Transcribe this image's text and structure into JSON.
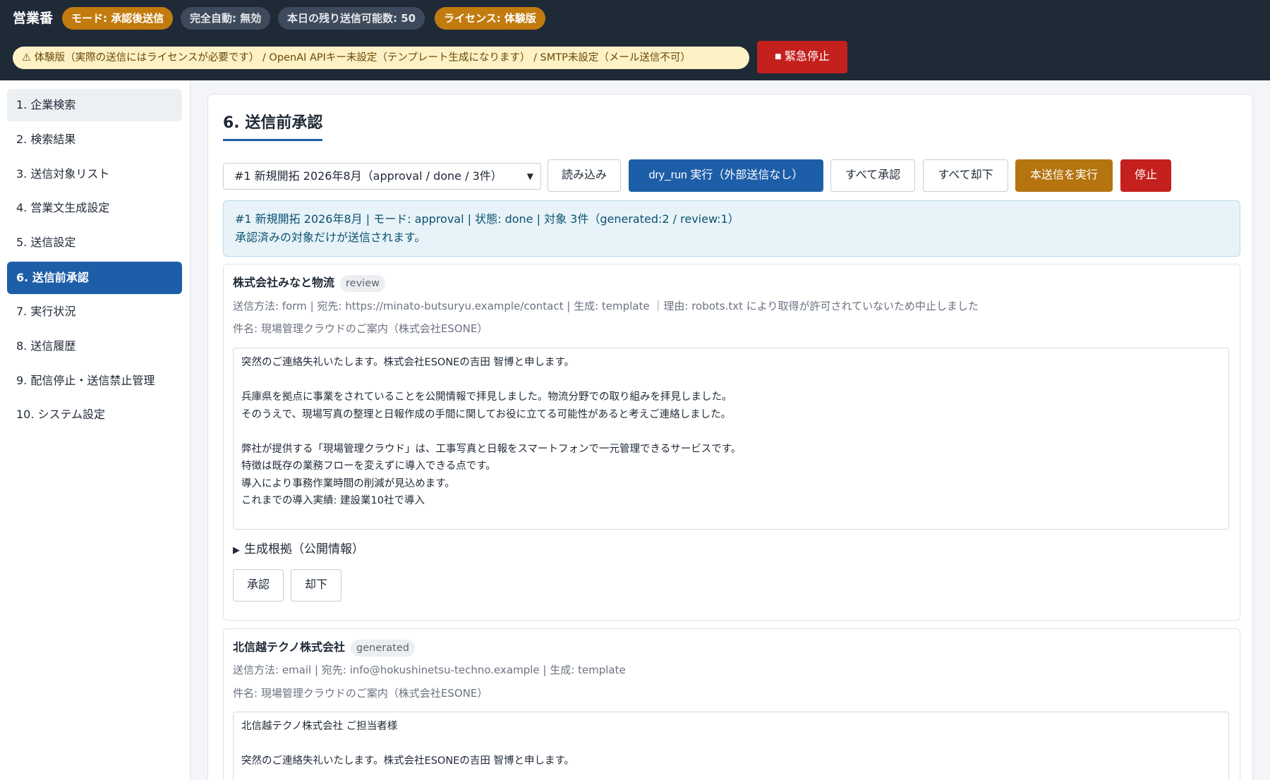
{
  "header": {
    "brand": "営業番",
    "badges": {
      "mode": "モード: 承認後送信",
      "full_auto": "完全自動: 無効",
      "remaining": "本日の残り送信可能数: 50",
      "license": "ライセンス: 体験版"
    },
    "warning_icon": "warning-triangle-icon",
    "warning_text": "⚠ 体験版（実際の送信にはライセンスが必要です） / OpenAI APIキー未設定（テンプレート生成になります） / SMTP未設定（メール送信不可）",
    "emergency_stop_label": "■ 緊急停止"
  },
  "sidebar": {
    "items": [
      {
        "label": "1. 企業検索"
      },
      {
        "label": "2. 検索結果"
      },
      {
        "label": "3. 送信対象リスト"
      },
      {
        "label": "4. 営業文生成設定"
      },
      {
        "label": "5. 送信設定"
      },
      {
        "label": "6. 送信前承認"
      },
      {
        "label": "7. 実行状況"
      },
      {
        "label": "8. 送信履歴"
      },
      {
        "label": "9. 配信停止・送信禁止管理"
      },
      {
        "label": "10. システム設定"
      }
    ],
    "active_index": 5
  },
  "main": {
    "title": "6. 送信前承認",
    "job_select": {
      "value": "#1 新規開拓 2026年8月（approval / done / 3件）"
    },
    "buttons": {
      "load": "読み込み",
      "dry_run": "dry_run 実行（外部送信なし）",
      "approve_all": "すべて承認",
      "reject_all": "すべて却下",
      "execute": "本送信を実行",
      "stop": "停止"
    },
    "info": {
      "line1": "#1 新規開拓 2026年8月 | モード: approval | 状態: done | 対象 3件（generated:2 / review:1）",
      "line2": "承認済みの対象だけが送信されます。"
    },
    "cards": [
      {
        "company": "株式会社みなと物流",
        "status": "review",
        "meta": "送信方法: form | 宛先: https://minato-butsuryu.example/contact | 生成: template ｜理由: robots.txt により取得が許可されていないため中止しました",
        "subject": "件名: 現場管理クラウドのご案内（株式会社ESONE）",
        "body": "突然のご連絡失礼いたします。株式会社ESONEの吉田 智博と申します。\n\n兵庫県を拠点に事業をされていることを公開情報で拝見しました。物流分野での取り組みを拝見しました。\nそのうえで、現場写真の整理と日報作成の手間に関してお役に立てる可能性があると考えご連絡しました。\n\n弊社が提供する「現場管理クラウド」は、工事写真と日報をスマートフォンで一元管理できるサービスです。\n特徴は既存の業務フローを変えずに導入できる点です。\n導入により事務作業時間の削減が見込めます。\nこれまでの導入実績: 建設業10社で導入",
        "evidence_label": "生成根拠（公開情報）",
        "approve": "承認",
        "reject": "却下"
      },
      {
        "company": "北信越テクノ株式会社",
        "status": "generated",
        "meta": "送信方法: email | 宛先: info@hokushinetsu-techno.example | 生成: template",
        "subject": "件名: 現場管理クラウドのご案内（株式会社ESONE）",
        "body": "北信越テクノ株式会社 ご担当者様\n\n突然のご連絡失礼いたします。株式会社ESONEの吉田 智博と申します。"
      }
    ]
  }
}
